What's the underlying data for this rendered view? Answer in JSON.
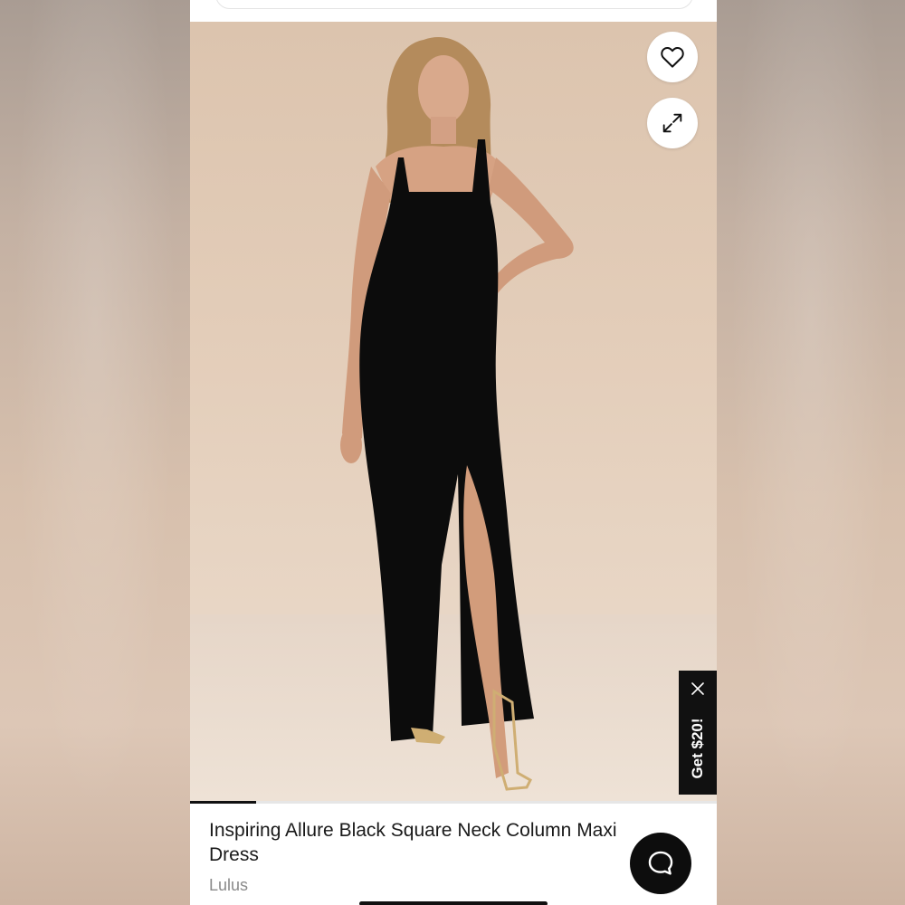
{
  "product": {
    "title": "Inspiring Allure Black Square Neck Column Maxi Dress",
    "brand": "Lulus"
  },
  "image_gallery": {
    "progress_fraction": 0.125
  },
  "promo": {
    "label": "Get $20!"
  },
  "icons": {
    "favorite": "heart-outline-icon",
    "expand": "expand-arrows-icon",
    "close": "close-icon",
    "chat": "chat-bubble-icon"
  },
  "colors": {
    "accent": "#111111",
    "background": "#ffffff",
    "muted_text": "#8a8a8a"
  }
}
